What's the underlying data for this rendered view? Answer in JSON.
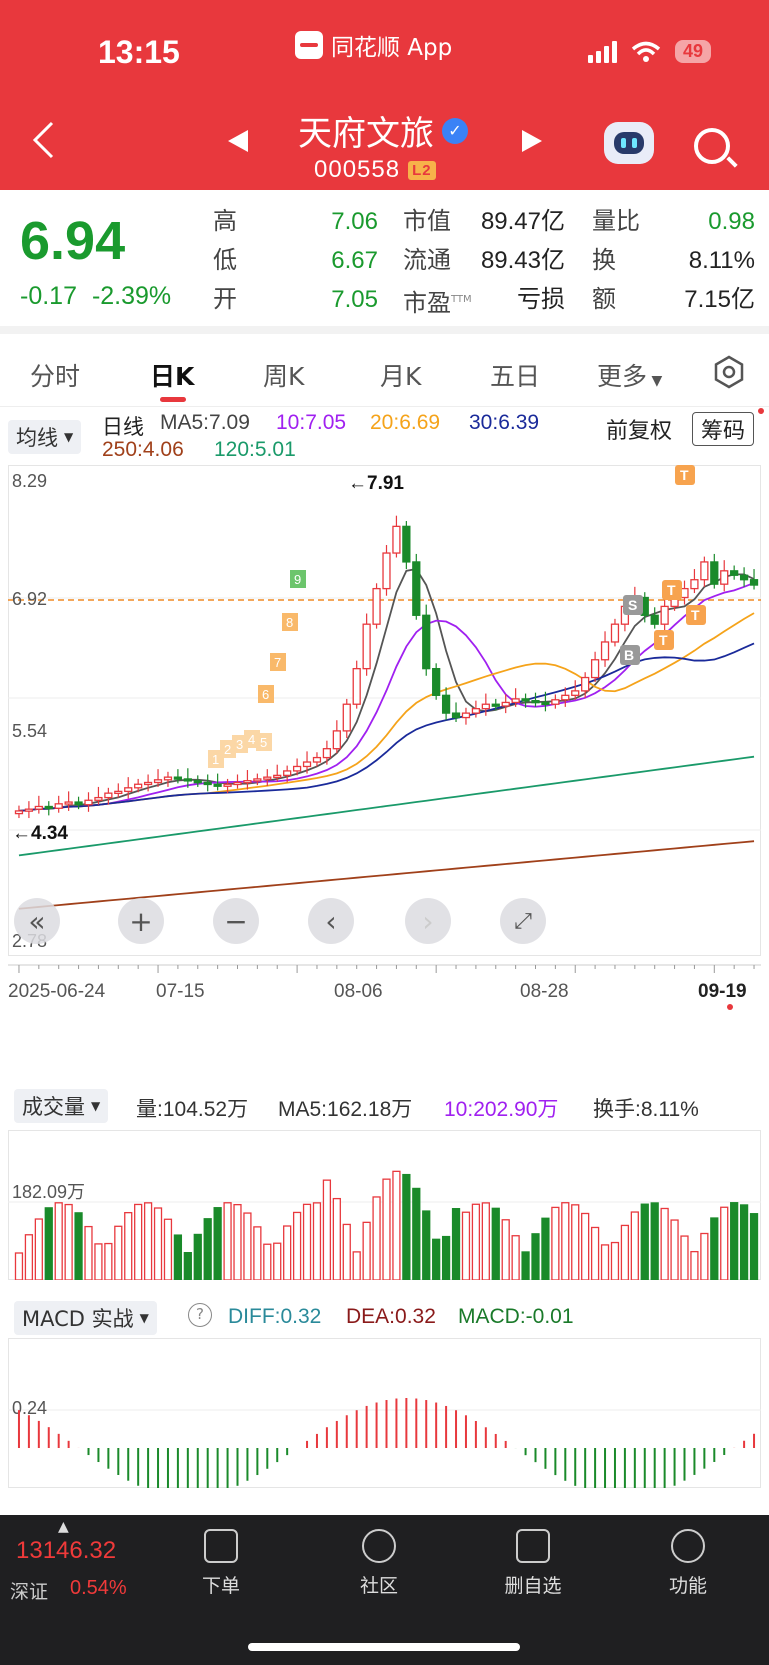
{
  "status": {
    "time": "13:15",
    "app": "同花顺 App",
    "battery": "49"
  },
  "stock": {
    "name": "天府文旅",
    "code": "000558",
    "level": "L2"
  },
  "quote": {
    "price": "6.94",
    "change": "-0.17",
    "change_pct": "-2.39%",
    "high_label": "高",
    "high": "7.06",
    "low_label": "低",
    "low": "6.67",
    "open_label": "开",
    "open": "7.05",
    "mcap_label": "市值",
    "mcap": "89.47亿",
    "float_label": "流通",
    "float": "89.43亿",
    "pe_label": "市盈",
    "pe_sup": "TTM",
    "pe": "亏损",
    "vr_label": "量比",
    "vr": "0.98",
    "turn_label": "换",
    "turn": "8.11%",
    "amt_label": "额",
    "amt": "7.15亿"
  },
  "tabs": [
    "分时",
    "日K",
    "周K",
    "月K",
    "五日",
    "更多"
  ],
  "active_tab": "日K",
  "ma_bar": {
    "selector": "均线",
    "period": "日线",
    "ma5": "MA5:7.09",
    "ma10": "10:7.05",
    "ma20": "20:6.69",
    "ma30": "30:6.39",
    "ma250": "250:4.06",
    "ma120": "120:5.01",
    "adjust": "前复权",
    "chips": "筹码"
  },
  "kline": {
    "y_top": "8.29",
    "y_mid": "6.92",
    "y_low": "5.54",
    "y_bottom": "2.78",
    "high_marker": "←7.91",
    "low_marker": "←4.34",
    "dates": [
      "2025-06-24",
      "07-15",
      "08-06",
      "08-28",
      "09-19"
    ],
    "signals": [
      "1",
      "2",
      "3",
      "4",
      "5",
      "6",
      "7",
      "8",
      "9"
    ]
  },
  "volume_bar": {
    "selector": "成交量",
    "vol": "量:104.52万",
    "ma5": "MA5:162.18万",
    "ma10": "10:202.90万",
    "turnover": "换手:8.11%",
    "axis": "182.09万"
  },
  "macd_bar": {
    "selector": "MACD 实战",
    "help": "?",
    "diff": "DIFF:0.32",
    "dea": "DEA:0.32",
    "macd": "MACD:-0.01",
    "axis": "0.24"
  },
  "colors": {
    "up": "#e8383d",
    "down": "#1a8a2a",
    "ma5": "#555555",
    "ma10": "#a020f0",
    "ma20": "#f5a31a",
    "ma30": "#1a2a9a",
    "ma120": "#1a9a6a",
    "ma250": "#a0401a"
  },
  "chart_data": {
    "type": "candlestick",
    "ylim": [
      2.78,
      8.29
    ],
    "closes": [
      4.4,
      4.42,
      4.45,
      4.43,
      4.48,
      4.5,
      4.47,
      4.52,
      4.55,
      4.6,
      4.62,
      4.66,
      4.7,
      4.72,
      4.75,
      4.78,
      4.76,
      4.74,
      4.72,
      4.7,
      4.68,
      4.7,
      4.72,
      4.74,
      4.76,
      4.78,
      4.8,
      4.85,
      4.9,
      4.95,
      5.0,
      5.1,
      5.3,
      5.6,
      6.0,
      6.5,
      6.9,
      7.3,
      7.6,
      7.2,
      6.6,
      6.0,
      5.7,
      5.5,
      5.45,
      5.5,
      5.55,
      5.6,
      5.58,
      5.62,
      5.66,
      5.64,
      5.62,
      5.6,
      5.65,
      5.7,
      5.75,
      5.9,
      6.1,
      6.3,
      6.5,
      6.7,
      6.8,
      6.6,
      6.5,
      6.7,
      6.8,
      6.9,
      7.0,
      7.2,
      6.95,
      7.1,
      7.05,
      7.0,
      6.94
    ]
  },
  "nav": {
    "index_value": "13146.32",
    "index_name": "深证",
    "index_pct": "0.54%",
    "items": [
      "下单",
      "社区",
      "删自选",
      "功能"
    ]
  }
}
